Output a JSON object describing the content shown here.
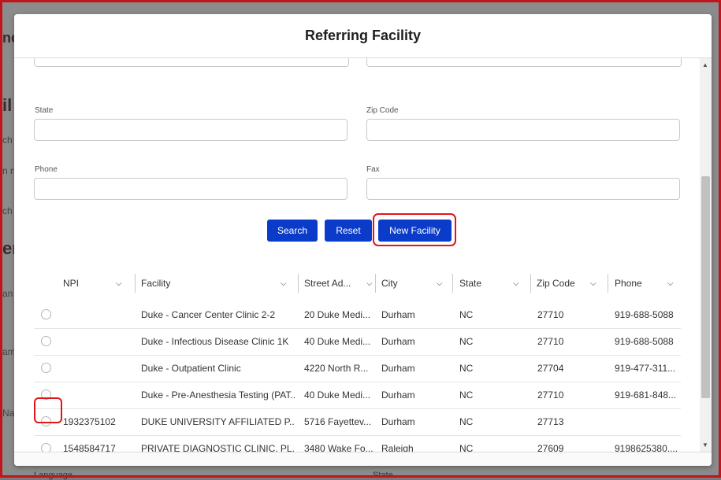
{
  "background": {
    "fragments": [
      "ne",
      "il",
      "ch",
      "n n",
      "ch",
      "er",
      "an",
      "am",
      "Na"
    ],
    "bottom_left": "Language",
    "bottom_right": "State"
  },
  "modal": {
    "title": "Referring Facility",
    "fields": {
      "state_label": "State",
      "zip_label": "Zip Code",
      "phone_label": "Phone",
      "fax_label": "Fax"
    },
    "buttons": {
      "search": "Search",
      "reset": "Reset",
      "new_facility": "New Facility"
    },
    "table": {
      "columns": [
        "NPI",
        "Facility",
        "Street Ad...",
        "City",
        "State",
        "Zip Code",
        "Phone"
      ],
      "rows": [
        [
          "",
          "Duke - Cancer Center Clinic 2-2",
          "20 Duke Medi...",
          "Durham",
          "NC",
          "27710",
          "919-688-5088"
        ],
        [
          "",
          "Duke - Infectious Disease Clinic 1K",
          "40 Duke Medi...",
          "Durham",
          "NC",
          "27710",
          "919-688-5088"
        ],
        [
          "",
          "Duke - Outpatient Clinic",
          "4220 North R...",
          "Durham",
          "NC",
          "27704",
          "919-477-311..."
        ],
        [
          "",
          "Duke - Pre-Anesthesia Testing (PAT...",
          "40 Duke Medi...",
          "Durham",
          "NC",
          "27710",
          "919-681-848..."
        ],
        [
          "1932375102",
          "DUKE UNIVERSITY AFFILIATED P...",
          "5716 Fayettev...",
          "Durham",
          "NC",
          "27713",
          ""
        ],
        [
          "1548584717",
          "PRIVATE DIAGNOSTIC CLINIC, PL...",
          "3480 Wake Fo...",
          "Raleigh",
          "NC",
          "27609",
          "9198625380,..."
        ]
      ]
    }
  },
  "colors": {
    "primary_button": "#0b3cc9",
    "highlight": "#e0151c",
    "frame": "#c0151c"
  }
}
